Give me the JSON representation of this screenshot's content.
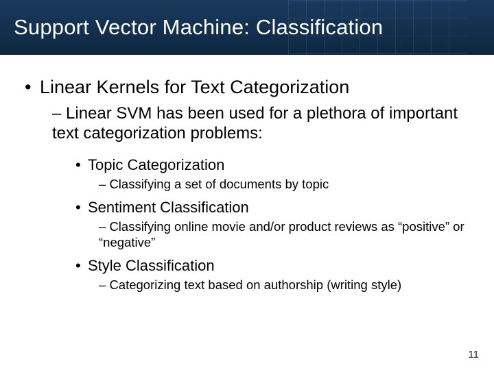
{
  "title": "Support Vector Machine: Classification",
  "headline": "Linear Kernels for Text Categorization",
  "subhead": "Linear SVM has been used for a plethora of important text categorization problems:",
  "items": [
    {
      "name": "Topic Categorization",
      "detail": "Classifying a set of documents by topic"
    },
    {
      "name": "Sentiment Classification",
      "detail": "Classifying online movie and/or product reviews as “positive” or “negative”"
    },
    {
      "name": "Style Classification",
      "detail": "Categorizing text based on authorship (writing style)"
    }
  ],
  "page_number": "11"
}
